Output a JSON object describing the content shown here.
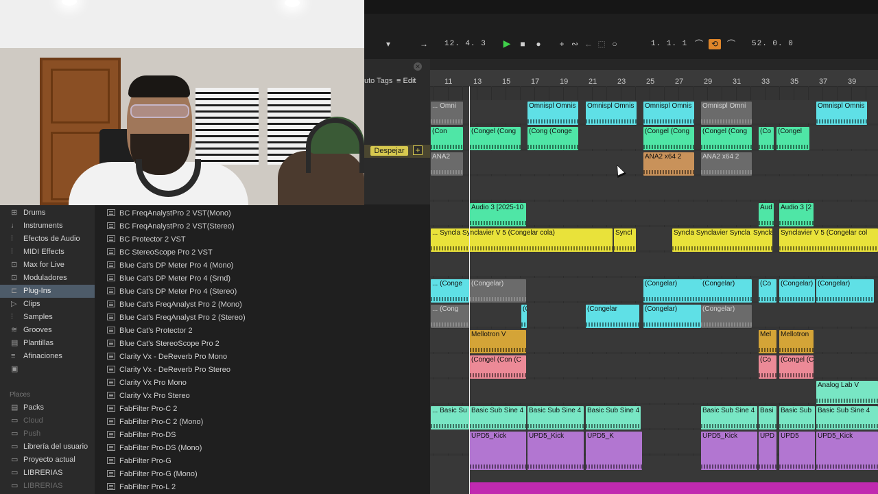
{
  "transport": {
    "position": "12.  4.  3",
    "loop_start": "1.  1.  1",
    "loop_length": "52.  0.  0"
  },
  "browser": {
    "auto_tags": "uto Tags",
    "edit": "Edit",
    "clear": "Despejar",
    "add": "+"
  },
  "sidebar": {
    "items": [
      {
        "label": "Drums",
        "icon": "drums-icon"
      },
      {
        "label": "Instruments",
        "icon": "instrument-icon"
      },
      {
        "label": "Efectos de Audio",
        "icon": "audio-effect-icon"
      },
      {
        "label": "MIDI Effects",
        "icon": "midi-effect-icon"
      },
      {
        "label": "Max for Live",
        "icon": "max-icon"
      },
      {
        "label": "Moduladores",
        "icon": "modulator-icon"
      },
      {
        "label": "Plug-Ins",
        "icon": "plugin-icon"
      },
      {
        "label": "Clips",
        "icon": "clip-icon"
      },
      {
        "label": "Samples",
        "icon": "sample-icon"
      },
      {
        "label": "Grooves",
        "icon": "groove-icon"
      },
      {
        "label": "Plantillas",
        "icon": "template-icon"
      },
      {
        "label": "Afinaciones",
        "icon": "tuning-icon"
      }
    ],
    "places_title": "Places",
    "places": [
      {
        "label": "Packs"
      },
      {
        "label": "Cloud"
      },
      {
        "label": "Push"
      },
      {
        "label": "Librería del usuario"
      },
      {
        "label": "Proyecto actual"
      },
      {
        "label": "LIBRERIAS"
      },
      {
        "label": "LIBRERIAS"
      }
    ]
  },
  "plugins": [
    "BC FreqAnalystPro 2 VST(Mono)",
    "BC FreqAnalystPro 2 VST(Stereo)",
    "BC Protector 2 VST",
    "BC StereoScope Pro 2 VST",
    "Blue Cat's DP Meter Pro 4 (Mono)",
    "Blue Cat's DP Meter Pro 4 (Srnd)",
    "Blue Cat's DP Meter Pro 4 (Stereo)",
    "Blue Cat's FreqAnalyst Pro 2 (Mono)",
    "Blue Cat's FreqAnalyst Pro 2 (Stereo)",
    "Blue Cat's Protector 2",
    "Blue Cat's StereoScope Pro 2",
    "Clarity Vx - DeReverb Pro Mono",
    "Clarity Vx - DeReverb Pro Stereo",
    "Clarity Vx Pro Mono",
    "Clarity Vx Pro Stereo",
    "FabFilter Pro-C 2",
    "FabFilter Pro-C 2 (Mono)",
    "FabFilter Pro-DS",
    "FabFilter Pro-DS (Mono)",
    "FabFilter Pro-G",
    "FabFilter Pro-G (Mono)",
    "FabFilter Pro-L 2"
  ],
  "ruler": [
    "11",
    "13",
    "15",
    "17",
    "19",
    "21",
    "23",
    "25",
    "27",
    "29",
    "31",
    "33",
    "35",
    "37",
    "39"
  ],
  "clips": [
    {
      "label": "... Omni",
      "color": "gray"
    },
    {
      "label": "Omnispl Omnis",
      "color": "cyan"
    },
    {
      "label": "Omnispl Omnis",
      "color": "cyan"
    },
    {
      "label": "Omnispl Omnis",
      "color": "cyan"
    },
    {
      "label": "Omnispl Omni",
      "color": "gray"
    },
    {
      "label": "Omnispl Omnis",
      "color": "cyan"
    },
    {
      "label": "(Con",
      "color": "green"
    },
    {
      "label": "(Congel (Cong",
      "color": "green"
    },
    {
      "label": "(Cong (Conge",
      "color": "green"
    },
    {
      "label": "(Congel (Cong",
      "color": "green"
    },
    {
      "label": "(Congel (Cong",
      "color": "green"
    },
    {
      "label": "(Co",
      "color": "green"
    },
    {
      "label": "(Congel",
      "color": "green"
    },
    {
      "label": "ANA2",
      "color": "gray"
    },
    {
      "label": "ANA2 x64 2",
      "color": "orange"
    },
    {
      "label": "ANA2 x64 2",
      "color": "gray"
    },
    {
      "label": "Audio 3 [2025-10",
      "color": "green"
    },
    {
      "label": "Aud",
      "color": "green"
    },
    {
      "label": "Audio 3 [2",
      "color": "green"
    },
    {
      "label": "... Syncla Synclavier V 5 (Congelar cola)",
      "color": "yellow"
    },
    {
      "label": "Syncl",
      "color": "yellow"
    },
    {
      "label": "Syncla Synclavier Syncla",
      "color": "yellow"
    },
    {
      "label": "Syncla",
      "color": "yellow"
    },
    {
      "label": "Synclavier V 5 (Congelar col",
      "color": "yellow"
    },
    {
      "label": "... (Conge",
      "color": "cyan"
    },
    {
      "label": "(Congelar)",
      "color": "gray"
    },
    {
      "label": "(Congelar)",
      "color": "cyan"
    },
    {
      "label": "(Congelar)",
      "color": "cyan"
    },
    {
      "label": "(Co",
      "color": "cyan"
    },
    {
      "label": "(Congelar)",
      "color": "cyan"
    },
    {
      "label": "(Congelar)",
      "color": "cyan"
    },
    {
      "label": "... (Cong",
      "color": "gray"
    },
    {
      "label": "(Co",
      "color": "cyan"
    },
    {
      "label": "(Congelar",
      "color": "cyan"
    },
    {
      "label": "(Congelar)",
      "color": "cyan"
    },
    {
      "label": "(Congelar)",
      "color": "gray"
    },
    {
      "label": "Mellotron V",
      "color": "amber"
    },
    {
      "label": "Mel",
      "color": "amber"
    },
    {
      "label": "Mellotron",
      "color": "amber"
    },
    {
      "label": "(Congel (Con (C",
      "color": "pink"
    },
    {
      "label": "(Co",
      "color": "pink"
    },
    {
      "label": "(Congel (C",
      "color": "pink"
    },
    {
      "label": "Analog Lab V",
      "color": "mint"
    },
    {
      "label": "... Basic Su",
      "color": "mint"
    },
    {
      "label": "Basic Sub Sine 4",
      "color": "mint"
    },
    {
      "label": "Basic Sub Sine 4",
      "color": "mint"
    },
    {
      "label": "Basic Sub Sine 4",
      "color": "mint"
    },
    {
      "label": "Basic Sub Sine 4",
      "color": "mint"
    },
    {
      "label": "Basi",
      "color": "mint"
    },
    {
      "label": "Basic Sub",
      "color": "mint"
    },
    {
      "label": "Basic Sub Sine 4",
      "color": "mint"
    },
    {
      "label": "UPD5_Kick",
      "color": "lilac"
    },
    {
      "label": "UPD5_Kick",
      "color": "lilac"
    },
    {
      "label": "UPD5_K",
      "color": "lilac"
    },
    {
      "label": "UPD5_Kick",
      "color": "lilac"
    },
    {
      "label": "UPD",
      "color": "lilac"
    },
    {
      "label": "UPD5",
      "color": "lilac"
    },
    {
      "label": "UPD5_Kick",
      "color": "lilac"
    }
  ]
}
